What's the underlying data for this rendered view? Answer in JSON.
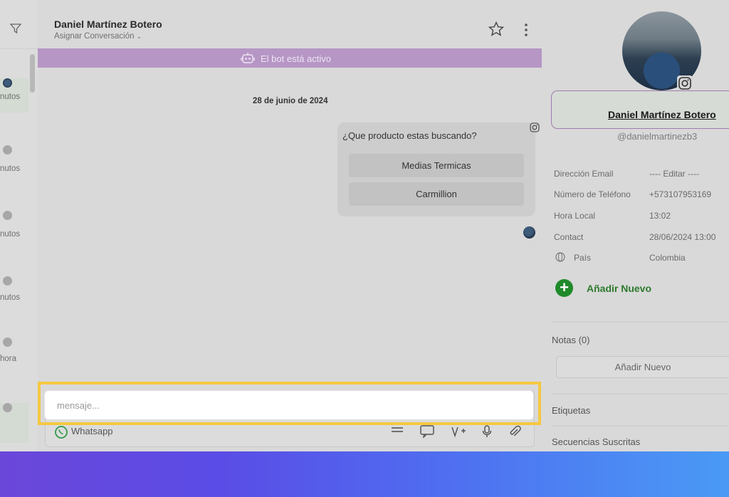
{
  "chat": {
    "contact_name": "Daniel Martínez Botero",
    "assign_label": "Asignar Conversación",
    "bot_status": "El bot está activo",
    "date_separator": "28 de junio de 2024",
    "message": {
      "question": "¿Que producto estas buscando?",
      "options": [
        "Medias Termicas",
        "Carmillion"
      ]
    }
  },
  "left_list": {
    "items": [
      {
        "label": "nutos"
      },
      {
        "label": "nutos"
      },
      {
        "label": "nutos"
      },
      {
        "label": "nutos"
      },
      {
        "label": "hora"
      }
    ]
  },
  "composer": {
    "placeholder": "mensaje...",
    "channel": "Whatsapp"
  },
  "contact": {
    "name": "Daniel Martínez Botero",
    "handle": "@danielmartinezb3",
    "fields": [
      {
        "label": "Dirección Email",
        "value": "---- Editar ----"
      },
      {
        "label": "Número de Teléfono",
        "value": "+573107953169"
      },
      {
        "label": "Hora Local",
        "value": "13:02"
      },
      {
        "label": "Contact",
        "value": "28/06/2024 13:00"
      },
      {
        "label": "País",
        "value": "Colombia"
      }
    ],
    "add_new": "Añadir Nuevo",
    "notes_title": "Notas (0)",
    "notes_add": "Añadir Nuevo",
    "tags_title": "Etiquetas",
    "sequences_title": "Secuencias Suscritas"
  },
  "colors": {
    "bot_bar": "#b696c5",
    "highlight": "#f5c842",
    "add_green": "#1f8a2a",
    "band_start": "#6b47d9",
    "band_end": "#4a9af5"
  }
}
